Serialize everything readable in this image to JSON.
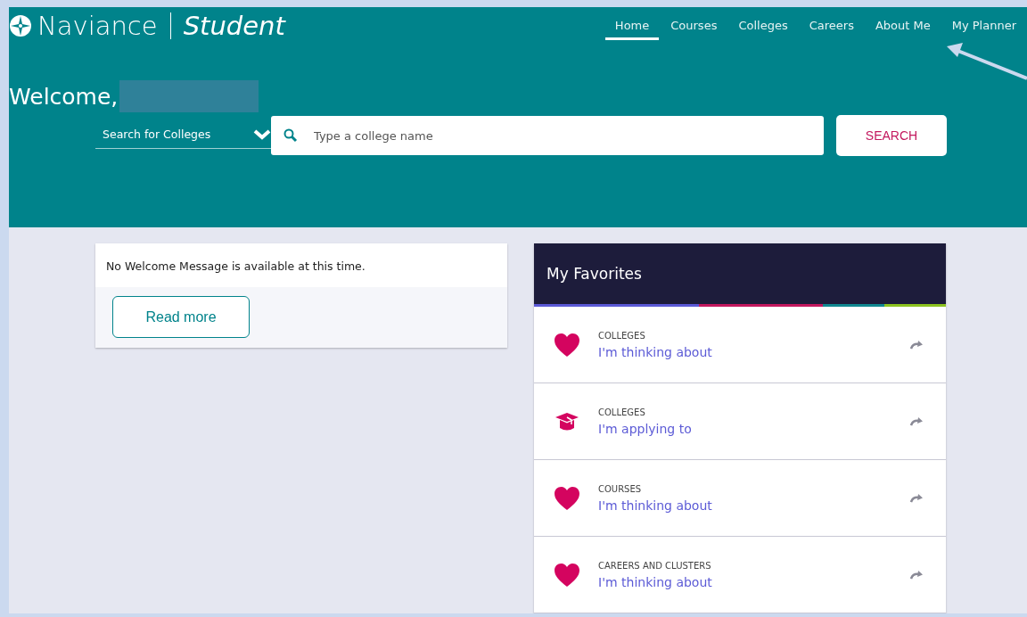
{
  "brand": {
    "name": "Naviance",
    "product": "Student"
  },
  "nav": [
    {
      "label": "Home",
      "selected": true
    },
    {
      "label": "Courses",
      "selected": false
    },
    {
      "label": "Colleges",
      "selected": false
    },
    {
      "label": "Careers",
      "selected": false
    },
    {
      "label": "About Me",
      "selected": false
    },
    {
      "label": "My Planner",
      "selected": false
    }
  ],
  "welcome": "Welcome,",
  "search": {
    "scope": "Search for Colleges",
    "placeholder": "Type a college name",
    "button": "SEARCH"
  },
  "message_card": {
    "text": "No Welcome Message is available at this time.",
    "button": "Read more"
  },
  "favorites": {
    "title": "My Favorites",
    "items": [
      {
        "kind": "heart",
        "category": "COLLEGES",
        "label": "I'm thinking about"
      },
      {
        "kind": "cap",
        "category": "COLLEGES",
        "label": "I'm applying to"
      },
      {
        "kind": "heart",
        "category": "COURSES",
        "label": "I'm thinking about"
      },
      {
        "kind": "heart",
        "category": "CAREERS AND CLUSTERS",
        "label": "I'm thinking about"
      }
    ]
  }
}
